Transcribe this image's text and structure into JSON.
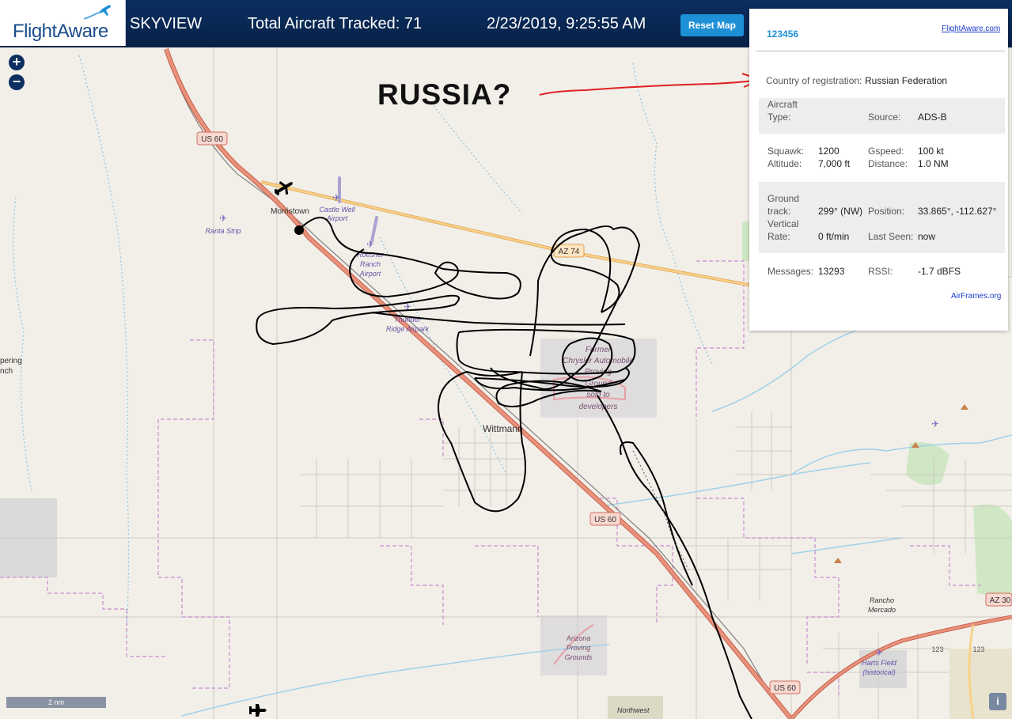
{
  "header": {
    "logo": "FlightAware",
    "app_name": "SKYVIEW",
    "aircraft_tracked": "Total Aircraft Tracked: 71",
    "datetime": "2/23/2019, 9:25:55 AM",
    "reset_label": "Reset Map"
  },
  "map": {
    "zoom_in": "+",
    "zoom_out": "−",
    "scale_label": "2 nm",
    "info_label": "i",
    "road_labels": [
      "US 60",
      "AZ 74",
      "US 60",
      "US 60",
      "AZ 30",
      "123",
      "123"
    ],
    "place_labels": [
      "Morristown",
      "Wittmann",
      "Rancho",
      "Mercado",
      "Northwest",
      "pering",
      "nch"
    ],
    "airport_labels": [
      [
        "Castle Well",
        "Airport"
      ],
      [
        "Ranta Strip"
      ],
      [
        "Roesner",
        "Ranch",
        "Airport"
      ],
      [
        "Thunder",
        "Ridge Airpark"
      ],
      [
        "Former",
        "Chrysler Automobile",
        "Proving",
        "Ground",
        "sold to",
        "developers"
      ],
      [
        "Arizona",
        "Proving",
        "Grounds"
      ],
      [
        "Harts Field",
        "(historical)"
      ]
    ]
  },
  "annotation": {
    "text": "RUSSIA?",
    "color": "#e02020"
  },
  "panel": {
    "flight_id": "123456",
    "fa_link": "FlightAware.com",
    "country_label": "Country of registration:",
    "country_value": "Russian Federation",
    "aircraft_type_label1": "Aircraft",
    "aircraft_type_label2": "Type:",
    "aircraft_type_value": "",
    "source_label": "Source:",
    "source_value": "ADS-B",
    "squawk_label": "Squawk:",
    "squawk_value": "1200",
    "gspeed_label": "Gspeed:",
    "gspeed_value": "100 kt",
    "altitude_label": "Altitude:",
    "altitude_value": "7,000 ft",
    "distance_label": "Distance:",
    "distance_value": "1.0 NM",
    "ground_label1": "Ground",
    "ground_label2": "track:",
    "ground_value": "299° (NW)",
    "position_label": "Position:",
    "position_value": "33.865°, -112.627°",
    "vrate_label1": "Vertical",
    "vrate_label2": "Rate:",
    "vrate_value": "0 ft/min",
    "lastseen_label": "Last Seen:",
    "lastseen_value": "now",
    "messages_label": "Messages:",
    "messages_value": "13293",
    "rssi_label": "RSSI:",
    "rssi_value": "-1.7 dBFS",
    "airframes_link": "AirFrames.org"
  },
  "colors": {
    "header_bg": "#0c2f60",
    "accent": "#1e90d6",
    "highway": "#e8927c",
    "state_route": "#f4b667",
    "boundary": "#c98ed0",
    "water": "#9fd1e9",
    "track": "#000000"
  }
}
